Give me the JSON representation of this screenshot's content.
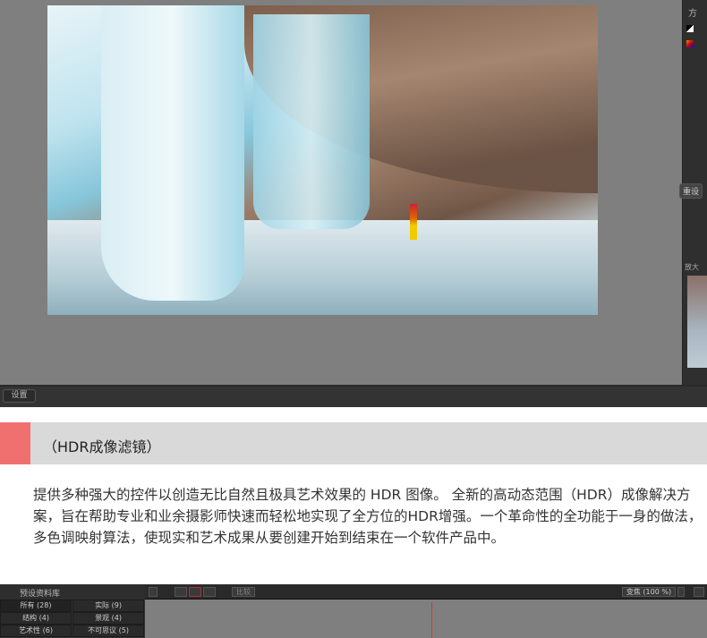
{
  "app": {
    "right_panel": {
      "label_top": "方",
      "reset_button": "重设",
      "zoom_section": "放大"
    },
    "bottom_bar": {
      "settings_button": "设置"
    }
  },
  "section": {
    "title": "（HDR成像滤镜）",
    "accent_color": "#f07070",
    "description": "提供多种强大的控件以创造无比自然且极具艺术效果的 HDR 图像。 全新的高动态范围（HDR）成像解决方案，旨在帮助专业和业余摄影师快速而轻松地实现了全方位的HDR增强。一个革命性的全功能于一身的做法，多色调映射算法，使现实和艺术成果从要创建开始到结束在一个软件产品中。"
  },
  "library": {
    "title": "预设资料库",
    "categories": [
      {
        "label": "所有 (28)"
      },
      {
        "label": "实际 (9)"
      },
      {
        "label": "结构 (4)"
      },
      {
        "label": "景观 (4)"
      },
      {
        "label": "艺术性 (6)"
      },
      {
        "label": "不可思议 (5)"
      }
    ],
    "compare_button": "比较",
    "zoom_select": "变焦 (100 %)"
  }
}
